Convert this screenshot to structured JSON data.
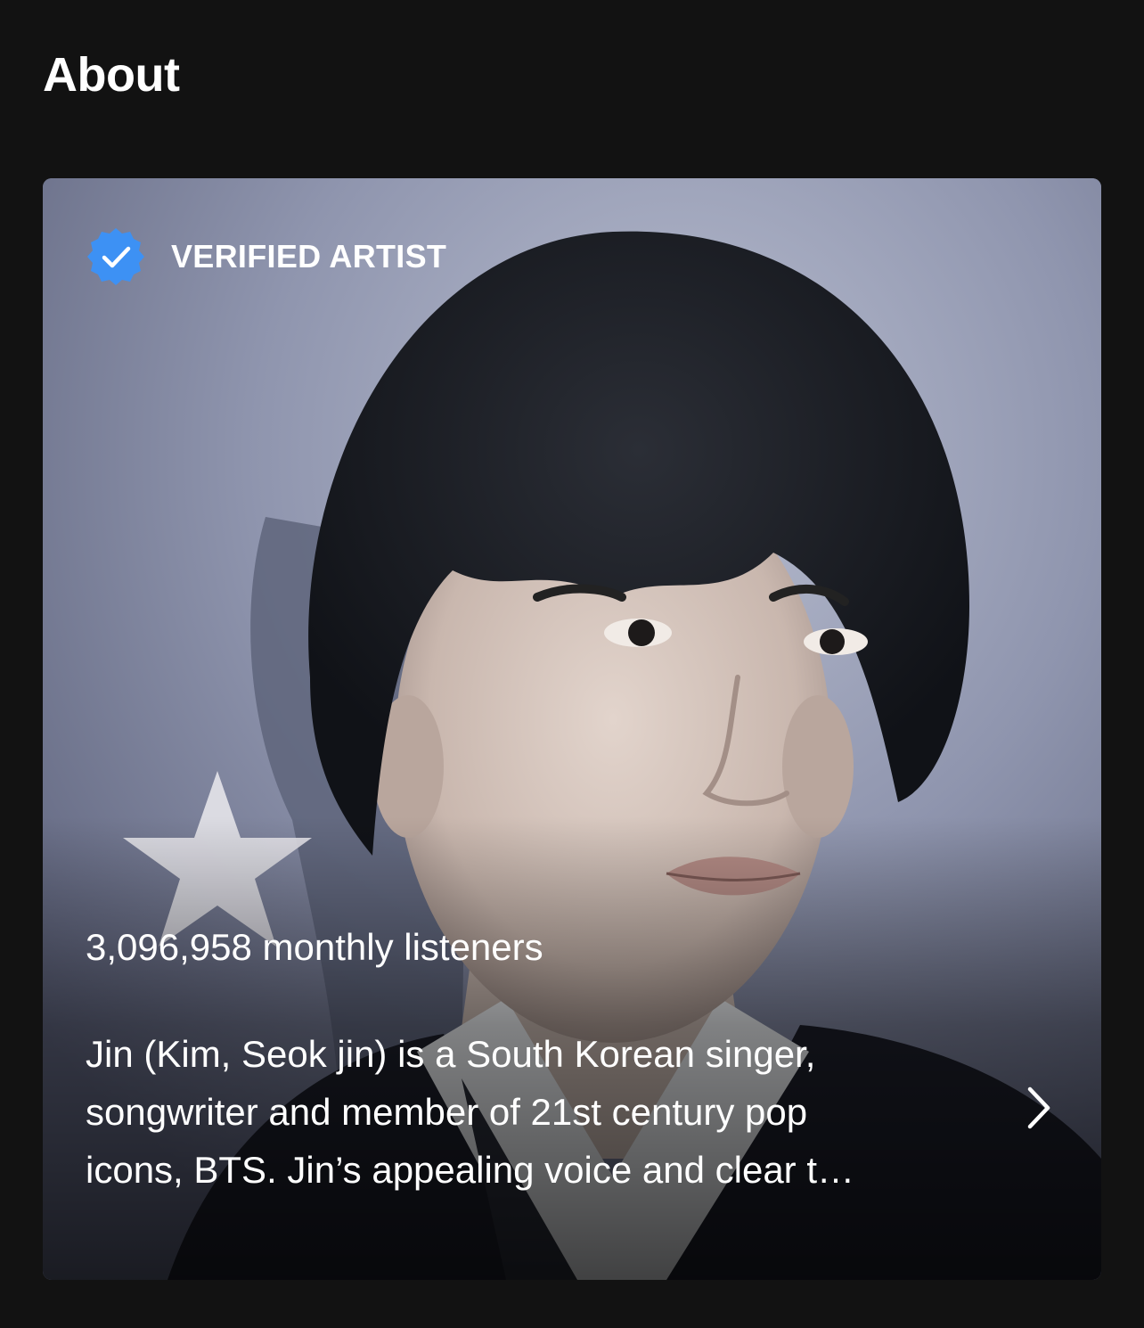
{
  "section": {
    "title": "About"
  },
  "card": {
    "verified_label": "VERIFIED ARTIST",
    "monthly_listeners": "3,096,958 monthly listeners",
    "bio_lines": [
      "Jin (Kim, Seok jin) is a South Korean singer,",
      "songwriter and member of 21st century pop",
      "icons, BTS. Jin’s appealing voice and clear t…"
    ],
    "verified_icon": "verified-badge-icon",
    "expand_icon": "chevron-right-icon"
  },
  "colors": {
    "background": "#121212",
    "verified_badge": "#3d91f4",
    "text": "#ffffff"
  }
}
